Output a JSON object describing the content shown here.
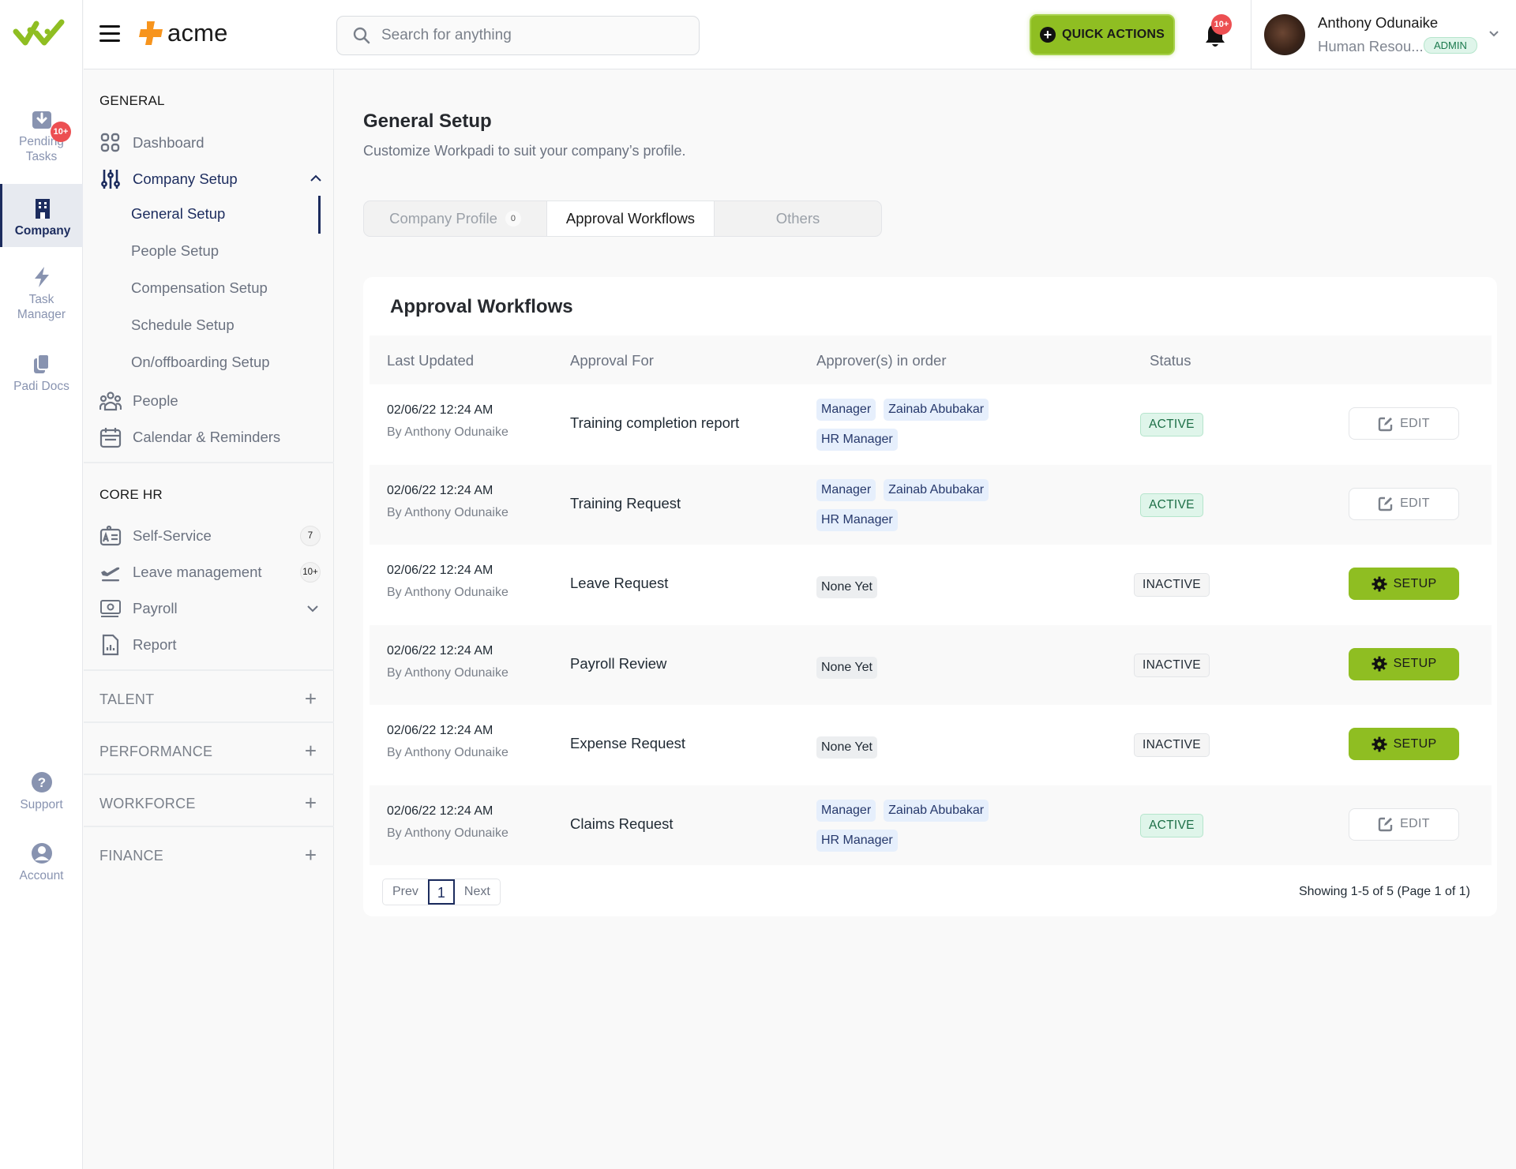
{
  "rail": {
    "items": [
      {
        "label_line1": "Pending",
        "label_line2": "Tasks",
        "badge": "10+"
      },
      {
        "label_line1": "Company",
        "label_line2": ""
      },
      {
        "label_line1": "Task",
        "label_line2": "Manager"
      },
      {
        "label_line1": "Padi Docs",
        "label_line2": ""
      },
      {
        "label_line1": "Support",
        "label_line2": ""
      },
      {
        "label_line1": "Account",
        "label_line2": ""
      }
    ]
  },
  "header": {
    "brand": "acme",
    "search_placeholder": "Search for anything",
    "quick_actions": "QUICK ACTIONS",
    "notifications_badge": "10+",
    "user": {
      "name": "Anthony Odunaike",
      "role": "Human Resou...",
      "badge": "ADMIN"
    }
  },
  "sidebar": {
    "general_label": "GENERAL",
    "dashboard": "Dashboard",
    "company_setup": "Company Setup",
    "sub_items": [
      "General Setup",
      "People Setup",
      "Compensation Setup",
      "Schedule Setup",
      "On/offboarding Setup"
    ],
    "people": "People",
    "calendar": "Calendar & Reminders",
    "core_hr_label": "CORE HR",
    "self_service": "Self-Service",
    "self_service_badge": "7",
    "leave": "Leave management",
    "leave_badge": "10+",
    "payroll": "Payroll",
    "report": "Report",
    "collapsed_sections": [
      "TALENT",
      "PERFORMANCE",
      "WORKFORCE",
      "FINANCE"
    ]
  },
  "main": {
    "title": "General Setup",
    "subtitle": "Customize Workpadi to suit your company’s profile.",
    "tabs": [
      {
        "label": "Company Profile",
        "count": "0"
      },
      {
        "label": "Approval Workflows"
      },
      {
        "label": "Others"
      }
    ],
    "card_title": "Approval Workflows",
    "columns": [
      "Last Updated",
      "Approval For",
      "Approver(s) in order",
      "Status"
    ],
    "rows": [
      {
        "date": "02/06/22 12:24 AM",
        "by": "By Anthony Odunaike",
        "for": "Training completion report",
        "approvers": [
          "Manager",
          "Zainab Abubakar",
          "HR Manager"
        ],
        "status": "ACTIVE",
        "action": "EDIT"
      },
      {
        "date": "02/06/22 12:24 AM",
        "by": "By Anthony Odunaike",
        "for": "Training Request",
        "approvers": [
          "Manager",
          "Zainab Abubakar",
          "HR Manager"
        ],
        "status": "ACTIVE",
        "action": "EDIT"
      },
      {
        "date": "02/06/22 12:24 AM",
        "by": "By Anthony Odunaike",
        "for": "Leave Request",
        "approvers": [
          "None Yet"
        ],
        "status": "INACTIVE",
        "action": "SETUP"
      },
      {
        "date": "02/06/22 12:24 AM",
        "by": "By Anthony Odunaike",
        "for": "Payroll Review",
        "approvers": [
          "None Yet"
        ],
        "status": "INACTIVE",
        "action": "SETUP"
      },
      {
        "date": "02/06/22 12:24 AM",
        "by": "By Anthony Odunaike",
        "for": "Expense Request",
        "approvers": [
          "None Yet"
        ],
        "status": "INACTIVE",
        "action": "SETUP"
      },
      {
        "date": "02/06/22 12:24 AM",
        "by": "By Anthony Odunaike",
        "for": "Claims Request",
        "approvers": [
          "Manager",
          "Zainab Abubakar",
          "HR Manager"
        ],
        "status": "ACTIVE",
        "action": "EDIT"
      }
    ],
    "pagination": {
      "prev": "Prev",
      "current": "1",
      "next": "Next",
      "summary": "Showing 1-5 of 5 (Page 1 of 1)"
    }
  },
  "colors": {
    "accent_green": "#8fbe22",
    "navy": "#1c2c5e",
    "brand_orange": "#f7941d",
    "badge_red": "#ec4f52"
  }
}
